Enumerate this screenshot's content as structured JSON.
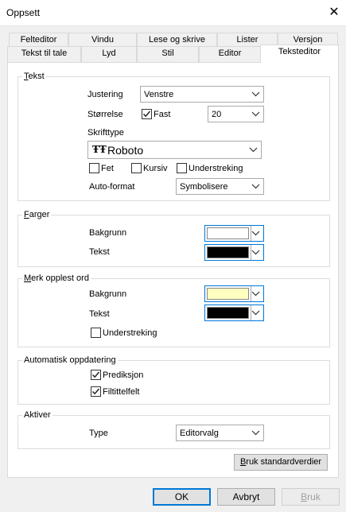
{
  "window": {
    "title": "Oppsett",
    "close_icon": "close-icon"
  },
  "tabs_row1": [
    {
      "label": "Felteditor"
    },
    {
      "label": "Vindu"
    },
    {
      "label": "Lese og skrive"
    },
    {
      "label": "Lister"
    },
    {
      "label": "Versjon"
    }
  ],
  "tabs_row2": [
    {
      "label": "Tekst til tale"
    },
    {
      "label": "Lyd"
    },
    {
      "label": "Stil"
    },
    {
      "label": "Editor"
    },
    {
      "label": "Teksteditor",
      "active": true
    }
  ],
  "tekst_group": {
    "title": "Tekst",
    "justering_label": "Justering",
    "justering_value": "Venstre",
    "storrelse_label": "Størrelse",
    "fast_label": "Fast",
    "fast_checked": true,
    "size_value": "20",
    "skrifttype_label": "Skrifttype",
    "font_value": "Roboto",
    "fet_label": "Fet",
    "kursiv_label": "Kursiv",
    "understreking_label": "Understreking",
    "autoformat_label": "Auto-format",
    "autoformat_value": "Symbolisere"
  },
  "farger_group": {
    "title": "Farger",
    "bakgrunn_label": "Bakgrunn",
    "bakgrunn_color": "#ffffff",
    "tekst_label": "Tekst",
    "tekst_color": "#000000"
  },
  "merk_group": {
    "title": "Merk opplest ord",
    "bakgrunn_label": "Bakgrunn",
    "bakgrunn_color": "#ffffc0",
    "tekst_label": "Tekst",
    "tekst_color": "#000000",
    "understreking_label": "Understreking"
  },
  "auto_group": {
    "title": "Automatisk oppdatering",
    "prediksjon_label": "Prediksjon",
    "prediksjon_checked": true,
    "filtittelfelt_label": "Filtittelfelt",
    "filtittelfelt_checked": true
  },
  "aktiver_group": {
    "title": "Aktiver",
    "type_label": "Type",
    "type_value": "Editorvalg"
  },
  "buttons": {
    "standard": "Bruk standardverdier",
    "ok": "OK",
    "avbryt": "Avbryt",
    "bruk": "Bruk"
  }
}
